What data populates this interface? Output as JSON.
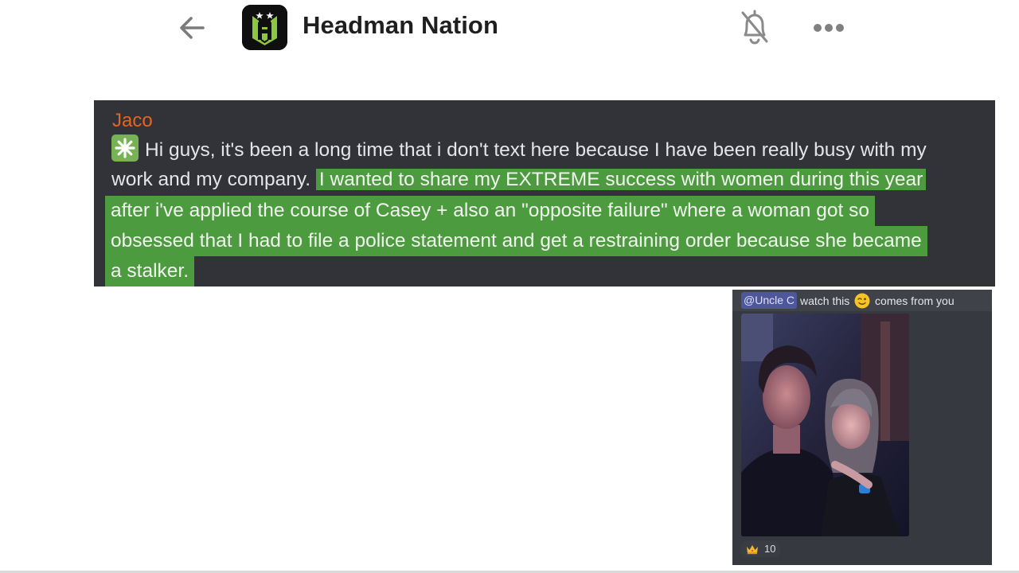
{
  "header": {
    "title": "Headman Nation",
    "back_icon": "back-arrow-icon",
    "logo_icon": "headman-logo",
    "mute_icon": "bell-off-icon",
    "more_icon": "more-horizontal-icon"
  },
  "message": {
    "author": "Jaco",
    "author_color": "#e8641e",
    "emoji": "sparkle",
    "lines": [
      "Hi guys, it's been a long time that i don't text here because I have been really busy with my",
      "work and my company.",
      "I wanted to share my EXTREME success with women during this year",
      "after i've applied the course of Casey + also an \"opposite failure\" where a woman got so",
      "obsessed that I had to file a police statement and get a restraining order because she became",
      "a stalker."
    ],
    "highlight_color": "#4d9b3f"
  },
  "reply": {
    "mention": "@Uncle C",
    "text_before": "watch this",
    "emoji": "wink",
    "text_after": "comes from you",
    "reaction_emoji": "crown",
    "reaction_count": "10"
  }
}
